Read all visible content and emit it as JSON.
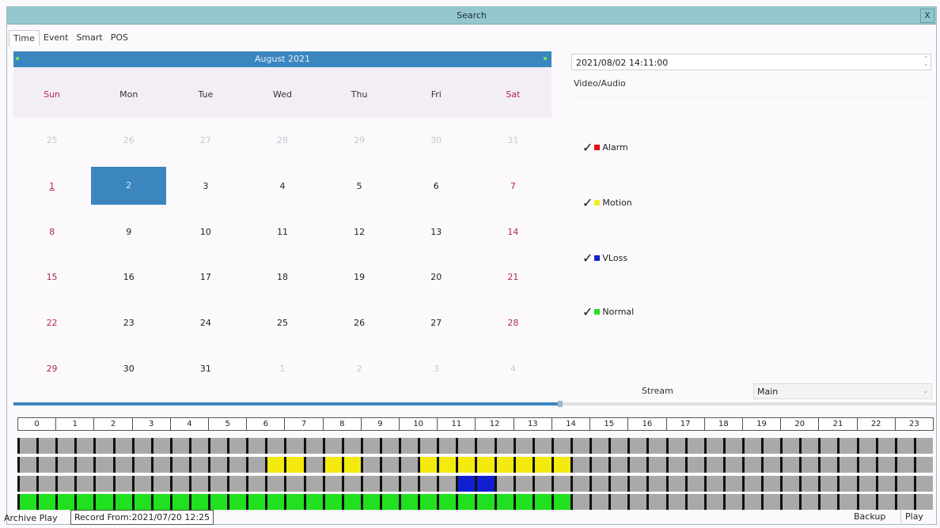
{
  "window": {
    "title": "Search",
    "close_label": "X"
  },
  "tabs": [
    {
      "label": "Time"
    },
    {
      "label": "Event"
    },
    {
      "label": "Smart"
    },
    {
      "label": "POS"
    }
  ],
  "calendar": {
    "month_label": "August  2021",
    "weekdays": [
      "Sun",
      "Mon",
      "Tue",
      "Wed",
      "Thu",
      "Fri",
      "Sat"
    ],
    "days": [
      "25",
      "26",
      "27",
      "28",
      "29",
      "30",
      "31",
      "1",
      "2",
      "3",
      "4",
      "5",
      "6",
      "7",
      "8",
      "9",
      "10",
      "11",
      "12",
      "13",
      "14",
      "15",
      "16",
      "17",
      "18",
      "19",
      "20",
      "21",
      "22",
      "23",
      "24",
      "25",
      "26",
      "27",
      "28",
      "29",
      "30",
      "31",
      "1",
      "2",
      "3",
      "4"
    ],
    "selected_day": "2"
  },
  "datetime": {
    "value": "2021/08/02 14:11:00"
  },
  "video_audio": {
    "title": "Video/Audio",
    "legend": [
      {
        "label": "Alarm",
        "color": "#e01010",
        "checked": true
      },
      {
        "label": "Motion",
        "color": "#f0f020",
        "checked": true
      },
      {
        "label": "VLoss",
        "color": "#1020d0",
        "checked": true
      },
      {
        "label": "Normal",
        "color": "#20e020",
        "checked": true
      }
    ]
  },
  "stream": {
    "label": "Stream",
    "value": "Main"
  },
  "timeline": {
    "hours": [
      "0",
      "1",
      "2",
      "3",
      "4",
      "5",
      "6",
      "7",
      "8",
      "9",
      "10",
      "11",
      "12",
      "13",
      "14",
      "15",
      "16",
      "17",
      "18",
      "19",
      "20",
      "21",
      "22",
      "23"
    ],
    "rows": [
      {
        "type": "Alarm",
        "color": "#e01010",
        "ranges": []
      },
      {
        "type": "Motion",
        "color": "#f5ea10",
        "ranges": [
          [
            6.5,
            7.5
          ],
          [
            8,
            9
          ],
          [
            10.5,
            14.5
          ]
        ]
      },
      {
        "type": "VLoss",
        "color": "#1020d0",
        "ranges": [
          [
            11.5,
            12.5
          ]
        ]
      },
      {
        "type": "Normal",
        "color": "#20e020",
        "ranges": [
          [
            0,
            14.5
          ]
        ]
      }
    ],
    "empty_color": "#a9a9a9"
  },
  "bottom": {
    "archive_label": "Archive Play",
    "record_from": "Record From:2021/07/20 12:25",
    "backup_label": "Backup",
    "play_label": "Play"
  },
  "progress": {
    "fraction": 0.593
  }
}
